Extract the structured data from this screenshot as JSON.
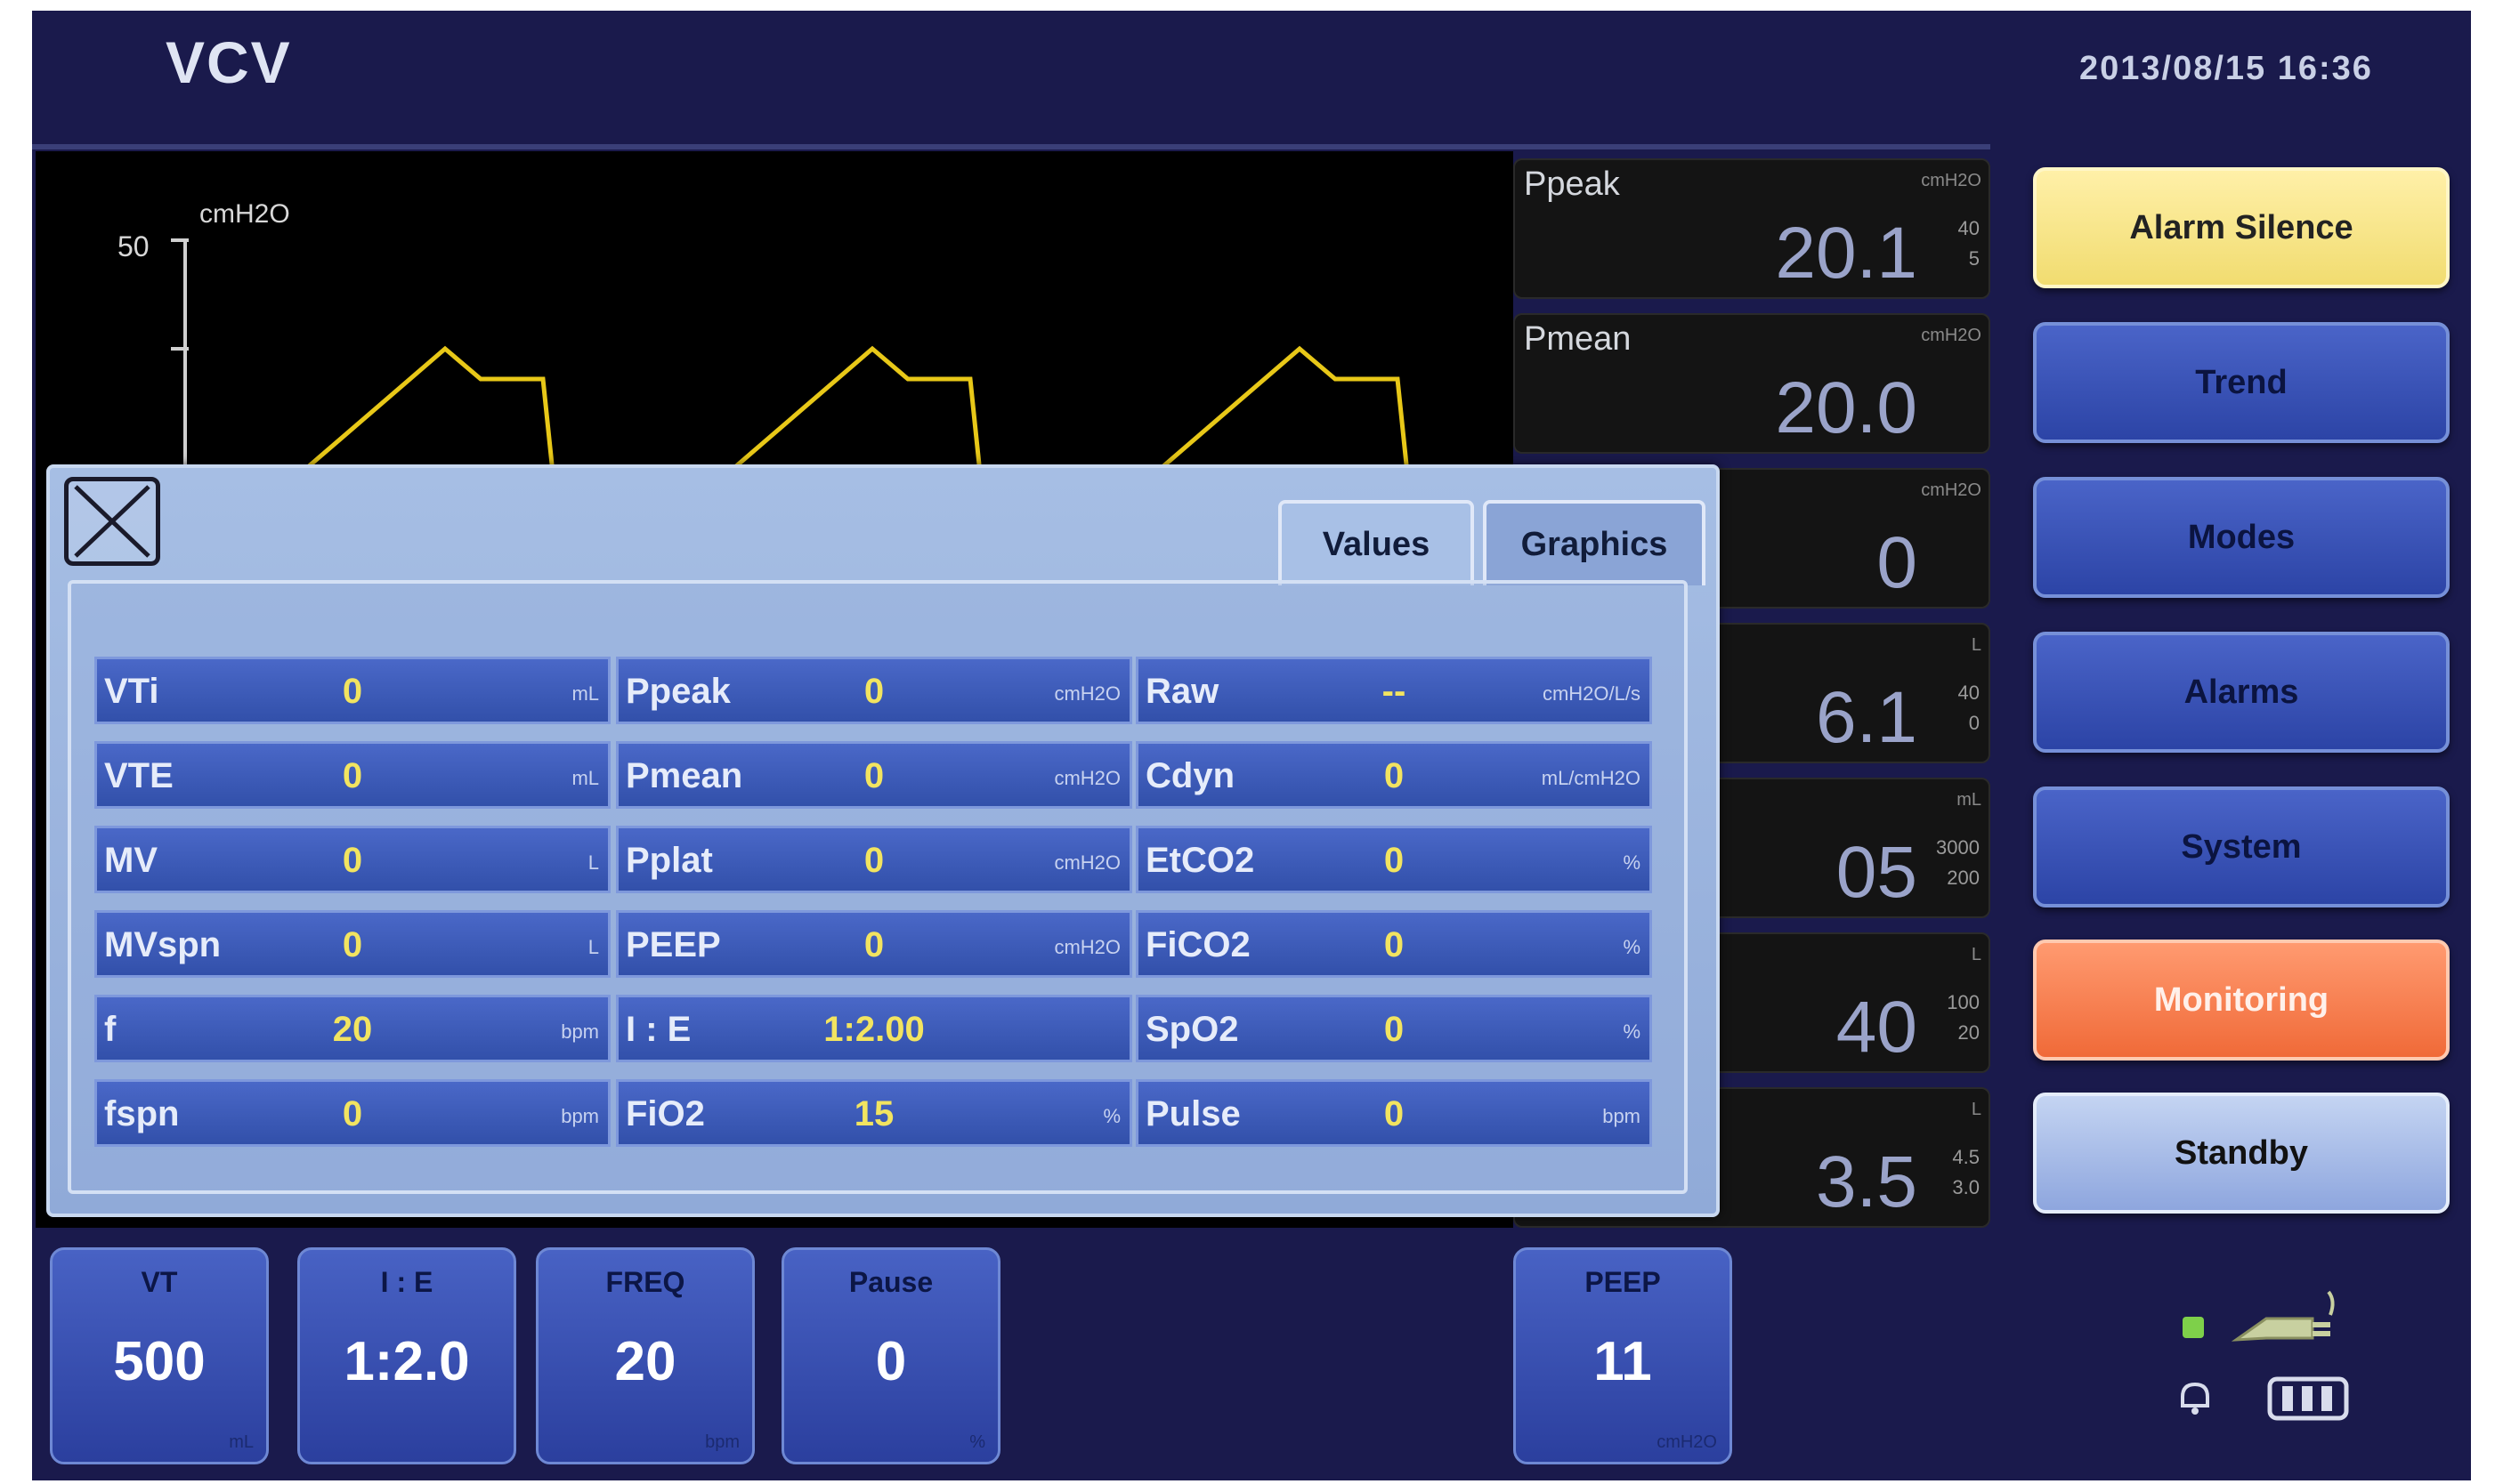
{
  "header": {
    "mode": "VCV",
    "datetime": "2013/08/15 16:36"
  },
  "waveform": {
    "scale_top": "50",
    "unit": "cmH2O",
    "color": "#e8c818"
  },
  "value_boxes": [
    {
      "label": "Ppeak",
      "value": "20.1",
      "unit": "cmH2O",
      "limits": [
        "40",
        "5"
      ]
    },
    {
      "label": "Pmean",
      "value": "20.0",
      "unit": "cmH2O",
      "limits": []
    },
    {
      "label": "",
      "value": "0",
      "unit": "cmH2O",
      "limits": []
    },
    {
      "label": "",
      "value": "6.1",
      "unit": "L",
      "limits": [
        "40",
        "0"
      ]
    },
    {
      "label": "",
      "value": "05",
      "unit": "mL",
      "limits": [
        "3000",
        "200"
      ]
    },
    {
      "label": "",
      "value": "40",
      "unit": "L",
      "limits": [
        "100",
        "20"
      ]
    },
    {
      "label": "",
      "value": "3.5",
      "unit": "L",
      "limits": [
        "4.5",
        "3.0"
      ]
    }
  ],
  "side_buttons": [
    {
      "label": "Alarm Silence",
      "style": "silence"
    },
    {
      "label": "Trend",
      "style": "normal"
    },
    {
      "label": "Modes",
      "style": "normal"
    },
    {
      "label": "Alarms",
      "style": "normal"
    },
    {
      "label": "System",
      "style": "normal"
    },
    {
      "label": "Monitoring",
      "style": "active"
    },
    {
      "label": "Standby",
      "style": "standby"
    }
  ],
  "settings": [
    {
      "label": "VT",
      "value": "500",
      "unit": "mL"
    },
    {
      "label": "I : E",
      "value": "1:2.0",
      "unit": ""
    },
    {
      "label": "FREQ",
      "value": "20",
      "unit": "bpm"
    },
    {
      "label": "Pause",
      "value": "0",
      "unit": "%"
    },
    {
      "label": "PEEP",
      "value": "11",
      "unit": "cmH2O"
    }
  ],
  "dialog": {
    "tabs": [
      "Values",
      "Graphics"
    ],
    "columns": [
      [
        {
          "label": "VTi",
          "value": "0",
          "unit": "mL"
        },
        {
          "label": "VTE",
          "value": "0",
          "unit": "mL"
        },
        {
          "label": "MV",
          "value": "0",
          "unit": "L"
        },
        {
          "label": "MVspn",
          "value": "0",
          "unit": "L"
        },
        {
          "label": "f",
          "value": "20",
          "unit": "bpm"
        },
        {
          "label": "fspn",
          "value": "0",
          "unit": "bpm"
        }
      ],
      [
        {
          "label": "Ppeak",
          "value": "0",
          "unit": "cmH2O"
        },
        {
          "label": "Pmean",
          "value": "0",
          "unit": "cmH2O"
        },
        {
          "label": "Pplat",
          "value": "0",
          "unit": "cmH2O"
        },
        {
          "label": "PEEP",
          "value": "0",
          "unit": "cmH2O"
        },
        {
          "label": "I : E",
          "value": "1:2.00",
          "unit": ""
        },
        {
          "label": "FiO2",
          "value": "15",
          "unit": "%"
        }
      ],
      [
        {
          "label": "Raw",
          "value": "--",
          "unit": "cmH2O/L/s"
        },
        {
          "label": "Cdyn",
          "value": "0",
          "unit": "mL/cmH2O"
        },
        {
          "label": "EtCO2",
          "value": "0",
          "unit": "%"
        },
        {
          "label": "FiCO2",
          "value": "0",
          "unit": "%"
        },
        {
          "label": "SpO2",
          "value": "0",
          "unit": "%"
        },
        {
          "label": "Pulse",
          "value": "0",
          "unit": "bpm"
        }
      ]
    ]
  }
}
